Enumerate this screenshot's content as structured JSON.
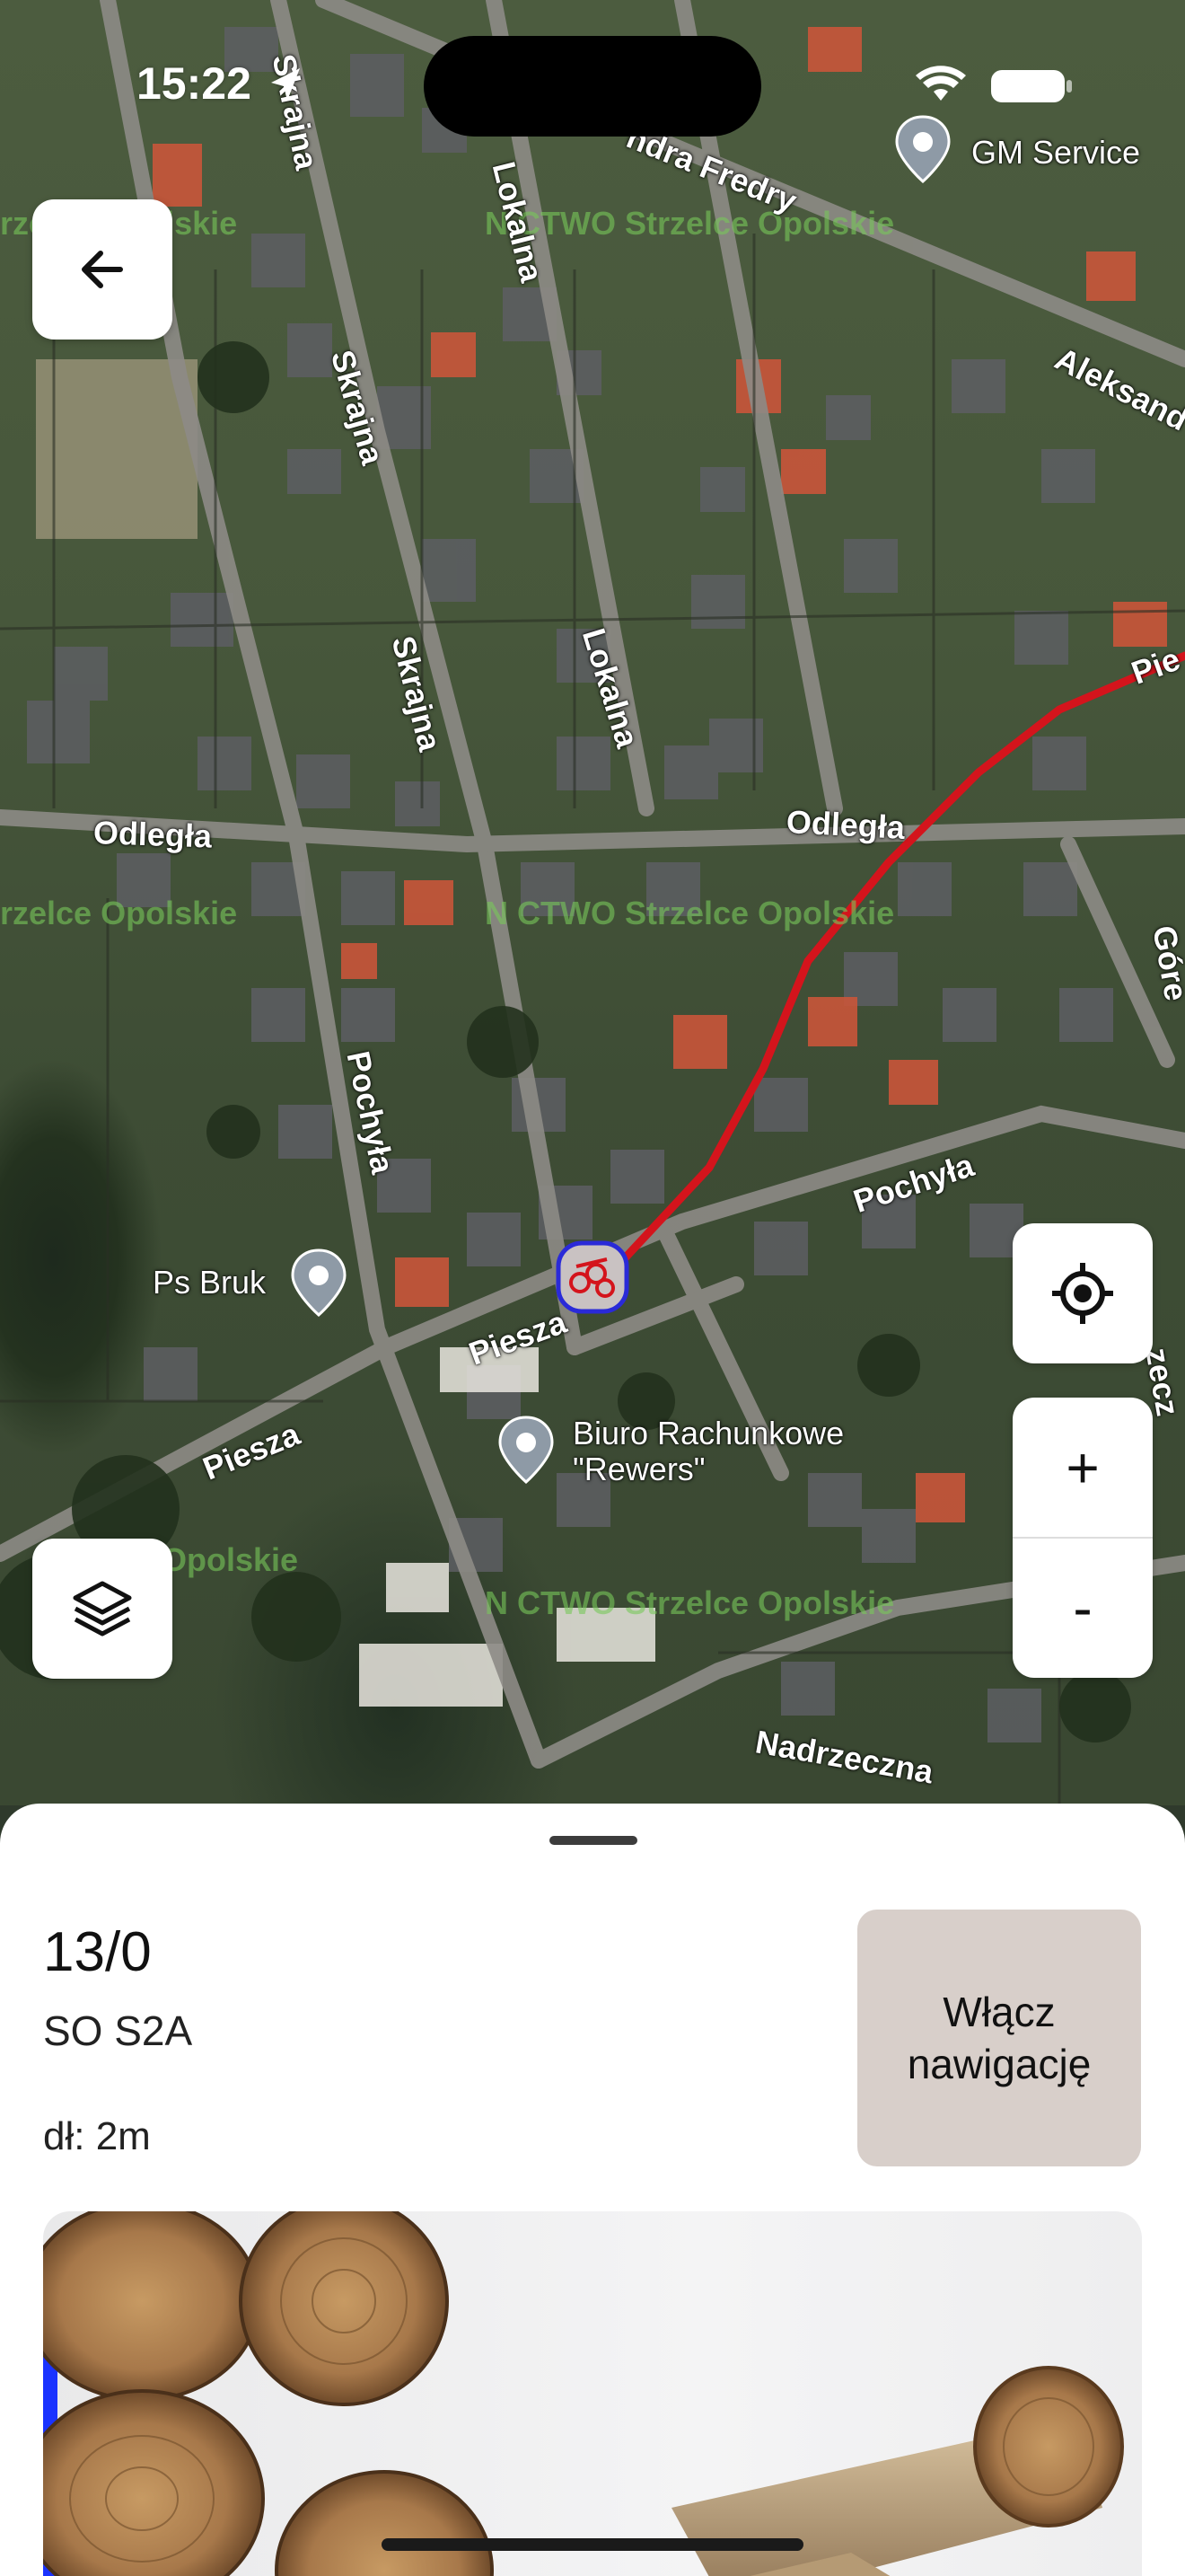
{
  "status_bar": {
    "time": "15:22"
  },
  "map": {
    "roads": {
      "skrajna_1": "Skrajna",
      "skrajna_2": "Skrajna",
      "skrajna_3": "Skrajna",
      "lokalna_1": "Lokalna",
      "lokalna_2": "Lokalna",
      "fredry": "ndra Fredry",
      "aleksand": "Aleksand",
      "odlegla_1": "Odległa",
      "odlegla_2": "Odległa",
      "pochyla_1": "Pochyła",
      "pochyla_2": "Pochyła",
      "piesza_1": "Piesza",
      "piesza_2": "Piesza",
      "nadrzeczna": "Nadrzeczna",
      "pie": "Pie",
      "gor": "Góre",
      "ecz": "zecz"
    },
    "pois": {
      "gm_service": "GM Service",
      "ps_bruk": "Ps Bruk",
      "biuro_line1": "Biuro Rachunkowe",
      "biuro_line2": "\"Rewers\""
    },
    "watermarks": {
      "w1": "N CTWO Strzelce Opolskie",
      "w2": "rzelce Opolskie",
      "w3": "N CTWO Strzelce Opolskie",
      "w4": "rzelce Opolskie",
      "w5": "N CTWO Strzelce Opolskie",
      "w6": "Opolskie"
    },
    "route_color": "#d4141c",
    "marker_color": "#2a2ad8"
  },
  "controls": {
    "back_icon": "arrow-left-icon",
    "layers_icon": "layers-icon",
    "locate_icon": "crosshair-icon",
    "zoom_in_label": "+",
    "zoom_out_label": "-"
  },
  "sheet": {
    "title": "13/0",
    "subtitle": "SO S2A",
    "length": "dł: 2m",
    "nav_button": "Włącz nawigację",
    "nav_button_bg": "#d8cfca"
  }
}
